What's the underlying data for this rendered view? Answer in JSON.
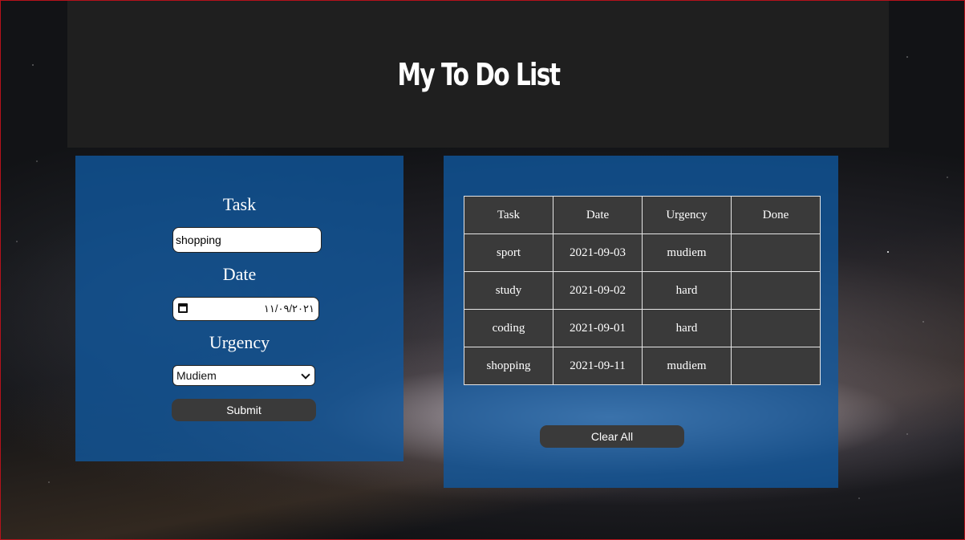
{
  "header": {
    "title": "My To Do List"
  },
  "form": {
    "task_label": "Task",
    "task_value": "shopping",
    "date_label": "Date",
    "date_value": "١١/٠٩/٢٠٢١",
    "urgency_label": "Urgency",
    "urgency_selected": "Mudiem",
    "submit_label": "Submit"
  },
  "table": {
    "headers": [
      "Task",
      "Date",
      "Urgency",
      "Done"
    ],
    "rows": [
      {
        "task": "sport",
        "date": "2021-09-03",
        "urgency": "mudiem",
        "done": ""
      },
      {
        "task": "study",
        "date": "2021-09-02",
        "urgency": "hard",
        "done": ""
      },
      {
        "task": "coding",
        "date": "2021-09-01",
        "urgency": "hard",
        "done": ""
      },
      {
        "task": "shopping",
        "date": "2021-09-11",
        "urgency": "mudiem",
        "done": ""
      }
    ]
  },
  "actions": {
    "clear_label": "Clear All"
  },
  "colors": {
    "header_bg": "#1f1f1f",
    "panel_bg": "#0f58a0",
    "button_bg": "#3a3a3a",
    "table_bg": "#3a3a3a"
  }
}
